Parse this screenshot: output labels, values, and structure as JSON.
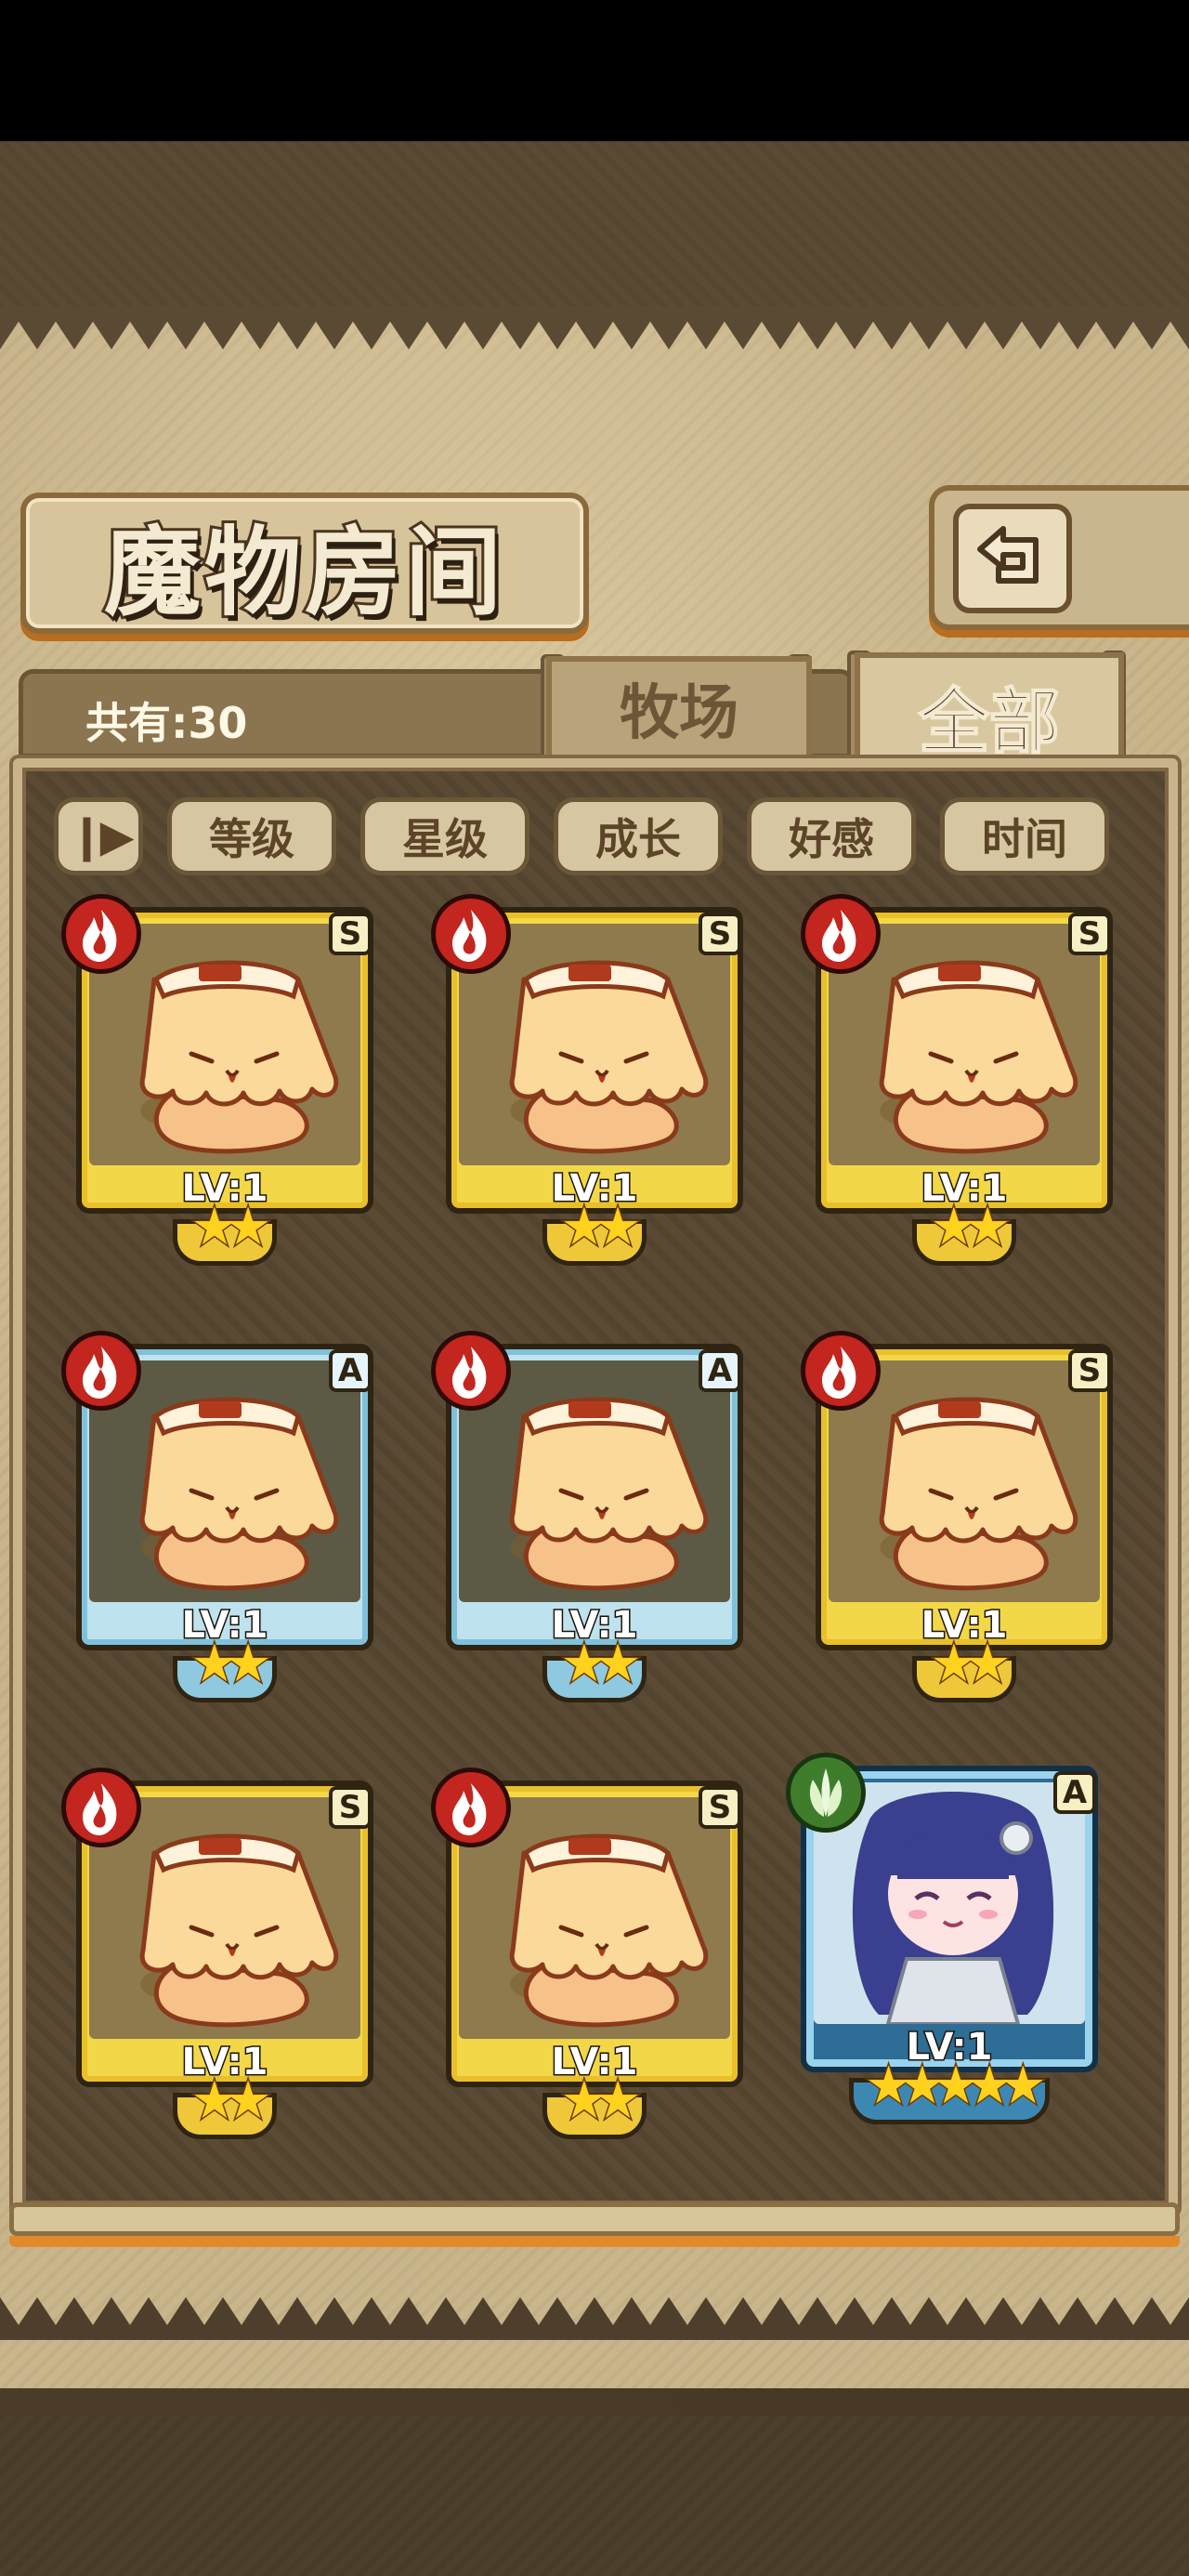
{
  "header": {
    "title": "魔物房间",
    "count_label": "共有:30"
  },
  "tabs": [
    {
      "label": "牧场"
    },
    {
      "label": "全部"
    }
  ],
  "sort_buttons": [
    {
      "label": "等级"
    },
    {
      "label": "星级"
    },
    {
      "label": "成长"
    },
    {
      "label": "好感"
    },
    {
      "label": "时间"
    }
  ],
  "monsters": [
    {
      "level": "LV:1",
      "rank": "S",
      "element": "fire-icon",
      "stars": "★★",
      "frame": "gold"
    },
    {
      "level": "LV:1",
      "rank": "S",
      "element": "fire-icon",
      "stars": "★★",
      "frame": "gold"
    },
    {
      "level": "LV:1",
      "rank": "S",
      "element": "fire-icon",
      "stars": "★★",
      "frame": "gold"
    },
    {
      "level": "LV:1",
      "rank": "A",
      "element": "fire-icon",
      "stars": "★★",
      "frame": "blue"
    },
    {
      "level": "LV:1",
      "rank": "A",
      "element": "fire-icon",
      "stars": "★★",
      "frame": "blue"
    },
    {
      "level": "LV:1",
      "rank": "S",
      "element": "fire-icon",
      "stars": "★★",
      "frame": "gold"
    },
    {
      "level": "LV:1",
      "rank": "S",
      "element": "fire-icon",
      "stars": "★★",
      "frame": "gold"
    },
    {
      "level": "LV:1",
      "rank": "S",
      "element": "fire-icon",
      "stars": "★★",
      "frame": "gold"
    },
    {
      "level": "LV:1",
      "rank": "A",
      "element": "leaf-icon",
      "stars": "★★★★★",
      "frame": "special"
    }
  ],
  "colors": {
    "gold_frame": "#f2d848",
    "blue_frame": "#bfe2ef",
    "fire": "#c3251f",
    "wood": "#3f7d2d",
    "panel": "#c9b58b",
    "accent_orange": "#e08a2a"
  }
}
